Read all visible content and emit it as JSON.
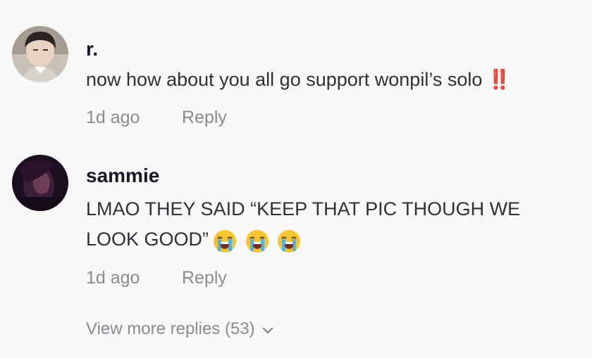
{
  "comments": [
    {
      "username": "r.",
      "text": "now how about you all go support wonpil’s solo ‼️",
      "time": "1d ago",
      "reply_label": "Reply",
      "avatar": "profile-photo-person"
    },
    {
      "username": "sammie",
      "text_line1": "LMAO THEY SAID “KEEP THAT PIC THOUGH WE",
      "text_line2": "LOOK GOOD”",
      "emojis": [
        "loudly-crying-face",
        "loudly-crying-face",
        "loudly-crying-face"
      ],
      "time": "1d ago",
      "reply_label": "Reply",
      "avatar": "profile-photo-dark"
    }
  ],
  "view_more": {
    "label": "View more replies (53)",
    "icon": "chevron-down-icon"
  },
  "colors": {
    "background": "#f8f8f8",
    "username": "#161823",
    "text": "#2f3036",
    "meta": "#8a8b91"
  }
}
